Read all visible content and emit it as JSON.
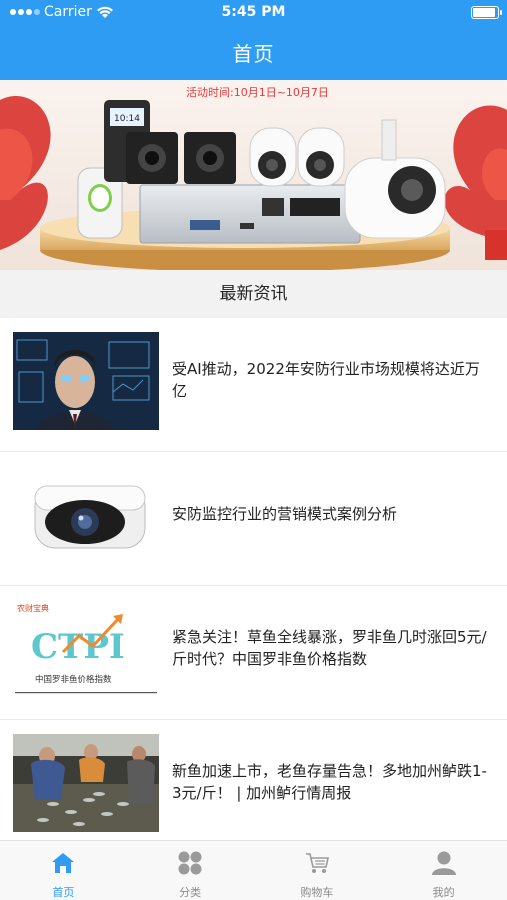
{
  "status_bar": {
    "carrier": "Carrier",
    "time": "5:45 PM"
  },
  "nav": {
    "title": "首页"
  },
  "banner": {
    "promo_text": "活动时间:10月1日~10月7日",
    "device_screen_text": "10:14"
  },
  "section": {
    "title": "最新资讯"
  },
  "news": [
    {
      "title": "受AI推动，2022年安防行业市场规模将达近万亿",
      "thumb": "ai-face-recognition"
    },
    {
      "title": "安防监控行业的营销模式案例分析",
      "thumb": "bullet-camera"
    },
    {
      "title": "紧急关注！草鱼全线暴涨，罗非鱼几时涨回5元/斤时代？中国罗非鱼价格指数",
      "thumb": "ctpi-logo",
      "thumb_text": {
        "top": "农财宝典",
        "logo": "CTPI",
        "caption": "中国罗非鱼价格指数"
      }
    },
    {
      "title": "新鱼加速上市，老鱼存量告急！多地加州鲈跌1-3元/斤！ | 加州鲈行情周报",
      "thumb": "fish-harvest"
    }
  ],
  "tabs": [
    {
      "label": "首页",
      "icon": "home-icon",
      "active": true
    },
    {
      "label": "分类",
      "icon": "category-icon",
      "active": false
    },
    {
      "label": "购物车",
      "icon": "cart-icon",
      "active": false
    },
    {
      "label": "我的",
      "icon": "profile-icon",
      "active": false
    }
  ],
  "colors": {
    "primary": "#2f9cf3",
    "section_bg": "#f2f2f2",
    "promo_red": "#e83a3a"
  }
}
